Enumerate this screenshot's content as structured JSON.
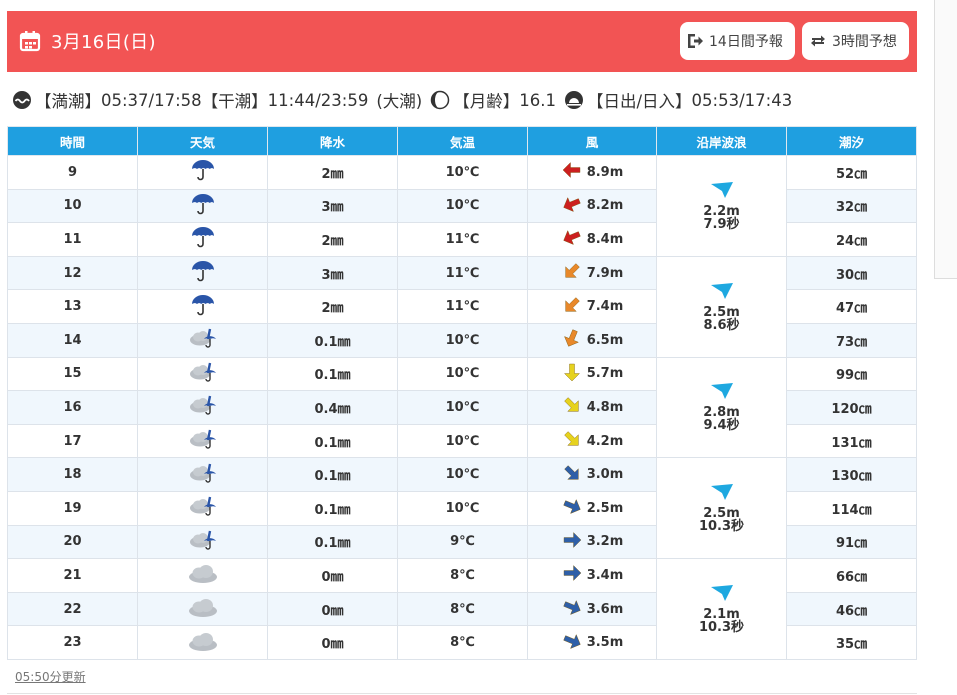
{
  "header": {
    "date": "3月16日(日)",
    "btn14": "14日間予報",
    "btn3": "3時間予想"
  },
  "tide": {
    "high_label": "【満潮】",
    "high": "05:37/17:58",
    "low_label": "【干潮】",
    "low": "11:44/23:59",
    "tide_type": "(大潮)",
    "moon_label": "【月齢】",
    "moon": "16.1",
    "sun_label": "【日出/日入】",
    "sun": "05:53/17:43"
  },
  "columns": [
    "時間",
    "天気",
    "降水",
    "気温",
    "風",
    "沿岸波浪",
    "潮汐"
  ],
  "rows": [
    {
      "hour": "9",
      "weather": "rain",
      "precip": "2㎜",
      "temp": "10℃",
      "wind_dir": "W",
      "wind_color": "#cc1f1f",
      "wind": "8.9m",
      "tide": "52㎝"
    },
    {
      "hour": "10",
      "weather": "rain",
      "precip": "3㎜",
      "temp": "10℃",
      "wind_dir": "WSW",
      "wind_color": "#cc1f1f",
      "wind": "8.2m",
      "tide": "32㎝"
    },
    {
      "hour": "11",
      "weather": "rain",
      "precip": "2㎜",
      "temp": "11℃",
      "wind_dir": "WSW",
      "wind_color": "#cc1f1f",
      "wind": "8.4m",
      "tide": "24㎝"
    },
    {
      "hour": "12",
      "weather": "rain",
      "precip": "3㎜",
      "temp": "11℃",
      "wind_dir": "SW",
      "wind_color": "#e8882a",
      "wind": "7.9m",
      "tide": "30㎝"
    },
    {
      "hour": "13",
      "weather": "rain",
      "precip": "2㎜",
      "temp": "11℃",
      "wind_dir": "SW",
      "wind_color": "#e8882a",
      "wind": "7.4m",
      "tide": "47㎝"
    },
    {
      "hour": "14",
      "weather": "cloud-rain",
      "precip": "0.1㎜",
      "temp": "10℃",
      "wind_dir": "SSW",
      "wind_color": "#e8882a",
      "wind": "6.5m",
      "tide": "73㎝"
    },
    {
      "hour": "15",
      "weather": "cloud-rain",
      "precip": "0.1㎜",
      "temp": "10℃",
      "wind_dir": "S",
      "wind_color": "#e6d21e",
      "wind": "5.7m",
      "tide": "99㎝"
    },
    {
      "hour": "16",
      "weather": "cloud-rain",
      "precip": "0.4㎜",
      "temp": "10℃",
      "wind_dir": "SE",
      "wind_color": "#e6d21e",
      "wind": "4.8m",
      "tide": "120㎝"
    },
    {
      "hour": "17",
      "weather": "cloud-rain",
      "precip": "0.1㎜",
      "temp": "10℃",
      "wind_dir": "SE",
      "wind_color": "#e6d21e",
      "wind": "4.2m",
      "tide": "131㎝"
    },
    {
      "hour": "18",
      "weather": "cloud-rain",
      "precip": "0.1㎜",
      "temp": "10℃",
      "wind_dir": "SE",
      "wind_color": "#2e5fa8",
      "wind": "3.0m",
      "tide": "130㎝"
    },
    {
      "hour": "19",
      "weather": "cloud-rain",
      "precip": "0.1㎜",
      "temp": "10℃",
      "wind_dir": "ESE",
      "wind_color": "#2e5fa8",
      "wind": "2.5m",
      "tide": "114㎝"
    },
    {
      "hour": "20",
      "weather": "cloud-rain",
      "precip": "0.1㎜",
      "temp": "9℃",
      "wind_dir": "E",
      "wind_color": "#2e5fa8",
      "wind": "3.2m",
      "tide": "91㎝"
    },
    {
      "hour": "21",
      "weather": "cloud",
      "precip": "0㎜",
      "temp": "8℃",
      "wind_dir": "E",
      "wind_color": "#2e5fa8",
      "wind": "3.4m",
      "tide": "66㎝"
    },
    {
      "hour": "22",
      "weather": "cloud",
      "precip": "0㎜",
      "temp": "8℃",
      "wind_dir": "ESE",
      "wind_color": "#2e5fa8",
      "wind": "3.6m",
      "tide": "46㎝"
    },
    {
      "hour": "23",
      "weather": "cloud",
      "precip": "0㎜",
      "temp": "8℃",
      "wind_dir": "ESE",
      "wind_color": "#2e5fa8",
      "wind": "3.5m",
      "tide": "35㎝"
    }
  ],
  "waves": [
    {
      "height": "2.2m",
      "period": "7.9秒"
    },
    {
      "height": "2.5m",
      "period": "8.6秒"
    },
    {
      "height": "2.8m",
      "period": "9.4秒"
    },
    {
      "height": "2.5m",
      "period": "10.3秒"
    },
    {
      "height": "2.1m",
      "period": "10.3秒"
    }
  ],
  "updated": "05:50分更新"
}
